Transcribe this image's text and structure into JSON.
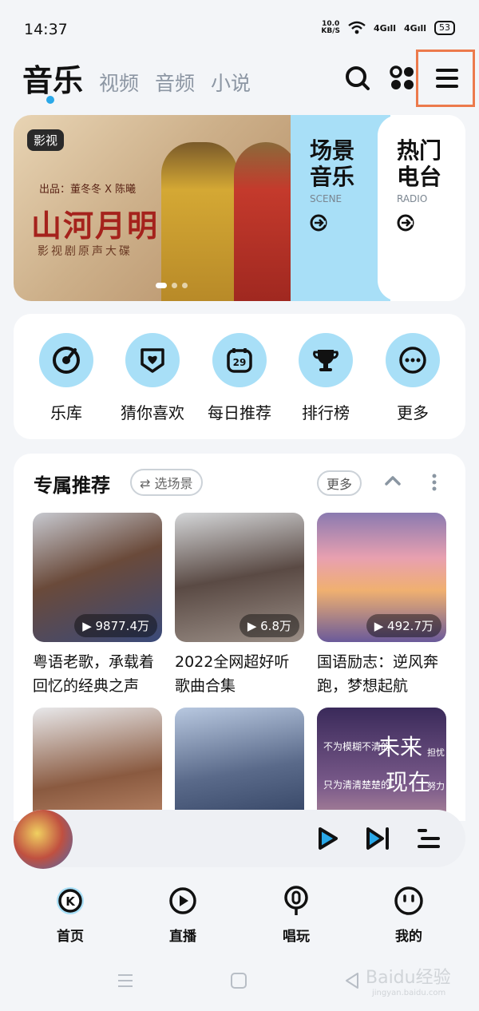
{
  "status_bar": {
    "time": "14:37",
    "net_speed_top": "10.0",
    "net_speed_bottom": "KB/S",
    "signal1": "4G",
    "signal2": "4G",
    "battery": "53"
  },
  "header": {
    "tabs": [
      "音乐",
      "视频",
      "音频",
      "小说"
    ],
    "active_tab": "音乐",
    "icons": [
      "search-icon",
      "apps-icon",
      "menu-icon"
    ],
    "highlight_color": "#ec7a4c"
  },
  "banner": {
    "badge": "影视",
    "credit": "出品：董冬冬 X 陈曦",
    "title": "山河月明",
    "subtitle": "影视剧原声大碟",
    "scene": {
      "title_line1": "场景",
      "title_line2": "音乐",
      "subtitle": "SCENE"
    },
    "radio": {
      "title_line1": "热门",
      "title_line2": "电台",
      "subtitle": "RADIO"
    }
  },
  "quick_nav": [
    {
      "label": "乐库",
      "icon": "music-library-icon"
    },
    {
      "label": "猜你喜欢",
      "icon": "heart-icon"
    },
    {
      "label": "每日推荐",
      "icon": "calendar-icon",
      "icon_text": "29"
    },
    {
      "label": "排行榜",
      "icon": "trophy-icon"
    },
    {
      "label": "更多",
      "icon": "more-icon"
    }
  ],
  "recommend": {
    "title": "专属推荐",
    "pick_scene": "⇄ 选场景",
    "more": "更多",
    "cards": [
      {
        "title": "粤语老歌，承载着回忆的经典之声",
        "plays": "▶ 9877.4万"
      },
      {
        "title": "2022全网超好听歌曲合集",
        "plays": "▶ 6.8万"
      },
      {
        "title": "国语励志：逆风奔跑，梦想起航",
        "plays": "▶ 492.7万"
      }
    ],
    "card6_text": [
      "不为模糊不清的",
      "未来",
      "只为清清楚楚的",
      "现在",
      "担忧",
      "努力"
    ]
  },
  "bottom_nav": [
    {
      "label": "首页",
      "icon": "home-k-icon"
    },
    {
      "label": "直播",
      "icon": "live-icon"
    },
    {
      "label": "唱玩",
      "icon": "microphone-icon"
    },
    {
      "label": "我的",
      "icon": "profile-icon"
    }
  ],
  "watermark": {
    "main": "Baidu经验",
    "sub": "jingyan.baidu.com"
  },
  "colors": {
    "accent_light_blue": "#a8dff7",
    "active_dot": "#2aa8e8"
  }
}
